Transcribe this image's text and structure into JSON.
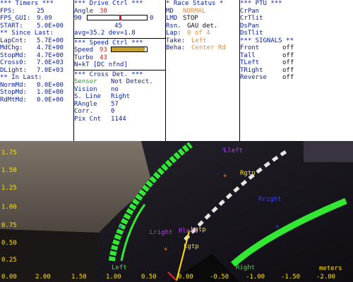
{
  "timers": {
    "header": "*** Timers ***",
    "rows": [
      {
        "label": "FPS:",
        "value": "25"
      },
      {
        "label": "FPS_GUI:",
        "value": "9.09"
      },
      {
        "label": "START:",
        "value": "5.0E+00"
      }
    ],
    "since_header": "** Since Last:",
    "since_rows": [
      {
        "label": "LapCnt:",
        "value": "5.7E+00"
      },
      {
        "label": "MdChg:",
        "value": "4.7E+00"
      },
      {
        "label": "StopMd:",
        "value": "4.7E+00"
      },
      {
        "label": "Cross0:",
        "value": "7.0E+03"
      },
      {
        "label": "DLight:",
        "value": "7.0E+03"
      }
    ],
    "in_header": "** In Last:",
    "in_rows": [
      {
        "label": "NormMd:",
        "value": "0.0E+00"
      },
      {
        "label": "StopMd:",
        "value": "1.0E+00"
      },
      {
        "label": "RdMtMd:",
        "value": "0.0E+00"
      }
    ]
  },
  "drive": {
    "header": "*** Drive Ctrl ***",
    "angle_label": "Angle",
    "angle_value": "38",
    "slider_min": "90",
    "slider_max": "0",
    "slider_fraction": 0.55,
    "slider_center": "45",
    "avg_text": "avg=35.2 dev=1.8",
    "speed_header": "*** Speed Ctrl ***",
    "speed_label": "Speed",
    "speed_value": "93",
    "speed_fraction": 0.93,
    "turbo_label": "Turbo",
    "turbo_value": "43",
    "nkt_text": "N+kT [DC nfnd]",
    "cross_header": "*** Cross Det. ***",
    "cross_rows": [
      {
        "label": "Sensor",
        "value": "Not Detect."
      },
      {
        "label": "Vision",
        "value": "no"
      },
      {
        "label": "S. Line",
        "value": "Right"
      },
      {
        "label": "RAngle",
        "value": "57"
      },
      {
        "label": "Corr.",
        "value": "0"
      },
      {
        "label": "Pix Cnt",
        "value": "1144"
      }
    ]
  },
  "race": {
    "header": "* Race Status *",
    "rows": [
      {
        "label": "MD",
        "value": "NORMAL"
      },
      {
        "label": "LMD",
        "value": "STOP"
      },
      {
        "label": "Rsn.",
        "value": "GAU det."
      },
      {
        "label": "Lap:",
        "value": "0 of 4"
      },
      {
        "label": "Take:",
        "value": "Left"
      },
      {
        "label": "Beha:",
        "value": "Center Rd"
      }
    ]
  },
  "ptu": {
    "header": "*** PTU ***",
    "items": [
      "CrPan",
      "CrTlit",
      "DsPan",
      "DsTlit"
    ],
    "signals_header": "*** SIGNALS **",
    "signals": [
      {
        "label": "Front",
        "value": "off"
      },
      {
        "label": "Tall",
        "value": "off"
      },
      {
        "label": "TLeft",
        "value": "off"
      },
      {
        "label": "TRight",
        "value": "off"
      },
      {
        "label": "Reverse",
        "value": "off"
      }
    ]
  },
  "camera": {
    "y_ticks": [
      "1.75",
      "1.50",
      "1.25",
      "1.00",
      "0.75",
      "0.50",
      "0.25"
    ],
    "x_ticks": [
      "0.00",
      "2.00",
      "1.50",
      "1.00",
      "0.50",
      "0.00",
      "-0.50",
      "-1.00",
      "-1.50",
      "-2.00"
    ],
    "units": "meters",
    "labels": {
      "left": "Left",
      "right": "Right",
      "rgtp": "Rgtp",
      "lgtp_a": "Lgtp",
      "lgtp_b": "Lgtp",
      "rright": "Rright",
      "lright": "Lright",
      "rleft": "Rleft",
      "lleft": "Lleft"
    },
    "colors": {
      "lane": "#33e833",
      "axis_text": "#ffe300",
      "marker_blue": "#3a3aff",
      "marker_magenta": "#c034ff",
      "marker_orange": "#ff7a2a",
      "target_line": "#ffe300"
    }
  }
}
